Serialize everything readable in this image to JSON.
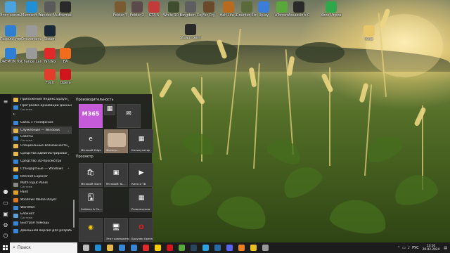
{
  "desktop": {
    "icons": [
      {
        "label": "Этот компьютер",
        "icon": "computer-icon",
        "color": "#4aa3df"
      },
      {
        "label": "Microsoft Edge",
        "icon": "edge-icon",
        "color": "#1f8fd6"
      },
      {
        "label": "Yandex Music",
        "icon": "yandex-music-icon",
        "color": "#5a5a5a"
      },
      {
        "label": "Foxmail",
        "icon": "foxmail-icon",
        "color": "#2a2a2a"
      },
      {
        "label": "Панель управления",
        "icon": "control-panel-icon",
        "color": "#2d7fd1"
      },
      {
        "label": "Отключить телеметрию",
        "icon": "privacy-icon",
        "color": "#9a9a9a"
      },
      {
        "label": "Steam",
        "icon": "steam-icon",
        "color": "#1b2838"
      },
      {
        "label": "DAEMON Tools Lite",
        "icon": "daemon-tools-icon",
        "color": "#2f7fd6"
      },
      {
        "label": "Change Language",
        "icon": "language-icon",
        "color": "#9a9a9a"
      },
      {
        "label": "Yandex",
        "icon": "yandex-browser-icon",
        "color": "#e02a2a"
      },
      {
        "label": "EA",
        "icon": "ea-icon",
        "color": "#f26c1e"
      },
      {
        "label": "Foxit",
        "icon": "foxit-icon",
        "color": "#e23c2c"
      },
      {
        "label": "Opera",
        "icon": "opera-icon",
        "color": "#d0161c"
      },
      {
        "label": "Folder 7",
        "icon": "game-folder-icon",
        "color": "#7a5a30"
      },
      {
        "label": "Folder 2",
        "icon": "game-folder-icon",
        "color": "#5a4a4a"
      },
      {
        "label": "GTA 5",
        "icon": "gta-icon",
        "color": "#c23a3a"
      },
      {
        "label": "While 10 Nature",
        "icon": "game-icon",
        "color": "#3e4e2e"
      },
      {
        "label": "Kingdom Come",
        "icon": "game-icon",
        "color": "#5e5e5e"
      },
      {
        "label": "Far Cry",
        "icon": "farcry-icon",
        "color": "#6a4a2a"
      },
      {
        "label": "Half-Life 2",
        "icon": "half-life-icon",
        "color": "#b86a1e"
      },
      {
        "label": "Counter-Strike",
        "icon": "counter-strike-icon",
        "color": "#5a6a3a"
      },
      {
        "label": "Uplay",
        "icon": "uplay-icon",
        "color": "#3b7dd8"
      },
      {
        "label": "uTorrent",
        "icon": "utorrent-icon",
        "color": "#5aa83c"
      },
      {
        "label": "Assassin's Creed",
        "icon": "assassins-creed-icon",
        "color": "#2a2a2a"
      },
      {
        "label": "Xbox Игровая",
        "icon": "xbox-icon",
        "color": "#2ea84a"
      },
      {
        "label": "Steam Game",
        "icon": "game-icon",
        "color": "#2a2a2a"
      },
      {
        "label": "Klob",
        "icon": "folder-icon",
        "color": "#e8c66a"
      }
    ]
  },
  "start_menu": {
    "rail": [
      "hamburger-icon",
      "user-icon",
      "document-icon",
      "pictures-icon",
      "settings-icon",
      "power-icon"
    ],
    "apps": [
      {
        "label": "Приложения Яндекс.Браузер",
        "sub": "",
        "icon": "folder-icon",
        "color": "#e8b84a",
        "chevron": "⌄",
        "selected": false
      },
      {
        "label": "Программа архивации данных",
        "sub": "Система",
        "icon": "backup-icon",
        "color": "#3a86d6",
        "chevron": "",
        "selected": false
      },
      {
        "label": "С",
        "sub": "",
        "icon": "",
        "color": "",
        "chevron": "",
        "selected": false
      },
      {
        "label": "Связь с телефоном",
        "sub": "",
        "icon": "phone-link-icon",
        "color": "#3a86d6",
        "chevron": "",
        "selected": false
      },
      {
        "label": "Служебные — Windows",
        "sub": "",
        "icon": "folder-icon",
        "color": "#e8b84a",
        "chevron": "⌄",
        "selected": true
      },
      {
        "label": "Советы",
        "sub": "Система",
        "icon": "tips-icon",
        "color": "#3a86d6",
        "chevron": "",
        "selected": false
      },
      {
        "label": "Специальные возможности Wi…",
        "sub": "",
        "icon": "folder-icon",
        "color": "#e8b84a",
        "chevron": "⌄",
        "selected": false
      },
      {
        "label": "Средства администрирования…",
        "sub": "",
        "icon": "folder-icon",
        "color": "#e8b84a",
        "chevron": "⌄",
        "selected": false
      },
      {
        "label": "Средство 3D-просмотра",
        "sub": "",
        "icon": "3d-viewer-icon",
        "color": "#3a86d6",
        "chevron": "",
        "selected": false
      },
      {
        "label": "Стандартные — Windows",
        "sub": "",
        "icon": "folder-icon",
        "color": "#e8b84a",
        "chevron": "⌃",
        "selected": false
      },
      {
        "label": "Internet Explorer",
        "sub": "",
        "icon": "ie-icon",
        "color": "#2d8fd9",
        "chevron": "",
        "selected": false
      },
      {
        "label": "Math Input Panel",
        "sub": "Система",
        "icon": "math-icon",
        "color": "#888888",
        "chevron": "",
        "selected": false
      },
      {
        "label": "Paint",
        "sub": "",
        "icon": "paint-icon",
        "color": "#e0a030",
        "chevron": "",
        "selected": false
      },
      {
        "label": "Windows Media Player",
        "sub": "",
        "icon": "media-player-icon",
        "color": "#e07a20",
        "chevron": "",
        "selected": false
      },
      {
        "label": "WordPad",
        "sub": "",
        "icon": "wordpad-icon",
        "color": "#3a86d6",
        "chevron": "",
        "selected": false
      },
      {
        "label": "Блокнот",
        "sub": "Система",
        "icon": "notepad-icon",
        "color": "#5aa0d8",
        "chevron": "",
        "selected": false
      },
      {
        "label": "Быстрая помощь",
        "sub": "",
        "icon": "quick-assist-icon",
        "color": "#3a86d6",
        "chevron": "",
        "selected": false
      },
      {
        "label": "Домашняя версия для разработч…",
        "sub": "",
        "icon": "dev-icon",
        "color": "#3a86d6",
        "chevron": "",
        "selected": false
      }
    ],
    "groups": {
      "productivity": "Производительность",
      "explore": "Просмотр"
    },
    "tiles": [
      {
        "label": "",
        "icon": "office-365-icon",
        "glyph": "M365",
        "color": "#c55bd8"
      },
      {
        "label": "",
        "icon": "office-apps-icon",
        "glyph": "▦",
        "color": "#3a3a3a"
      },
      {
        "label": "",
        "icon": "mail-icon",
        "glyph": "✉",
        "color": "#3a3a3a"
      },
      {
        "label": "Microsoft Edge",
        "icon": "edge-icon",
        "glyph": "e",
        "color": "#3a3a3a"
      },
      {
        "label": "Фотогр…",
        "icon": "photos-icon",
        "glyph": "",
        "color": "#8a7560"
      },
      {
        "label": "Калькулятор",
        "icon": "calculator-icon",
        "glyph": "▦",
        "color": "#3a3a3a"
      },
      {
        "label": "Microsoft Store",
        "icon": "store-icon",
        "glyph": "🛍",
        "color": "#3a3a3a"
      },
      {
        "label": "Microsoft To…",
        "icon": "todo-icon",
        "glyph": "▣",
        "color": "#3a3a3a"
      },
      {
        "label": "Кино и ТВ",
        "icon": "movies-icon",
        "glyph": "▶",
        "color": "#3a3a3a"
      },
      {
        "label": "Solitaire & Ca…",
        "icon": "solitaire-icon",
        "glyph": "🂡",
        "color": "#3a3a3a"
      },
      {
        "label": "Развлечения",
        "icon": "entertainment-icon",
        "glyph": "▦",
        "color": "#3a3a3a"
      },
      {
        "label": "Этот компьютер",
        "icon": "this-pc-icon",
        "glyph": "🖥",
        "color": "#3a3a3a"
      },
      {
        "label": "Браузер Opera",
        "icon": "opera-icon",
        "glyph": "O",
        "color": "#3a3a3a"
      },
      {
        "label": "",
        "icon": "yandex-music-icon",
        "glyph": "◉",
        "color": "#3a3a3a"
      }
    ]
  },
  "taskbar": {
    "search_placeholder": "Поиск",
    "pinned": [
      {
        "icon": "task-view-icon",
        "color": "#bbbbbb"
      },
      {
        "icon": "edge-icon",
        "color": "#1f8fd6"
      },
      {
        "icon": "explorer-icon",
        "color": "#e8b84a"
      },
      {
        "icon": "store-icon",
        "color": "#3a86d6"
      },
      {
        "icon": "mail-icon",
        "color": "#3a86d6"
      },
      {
        "icon": "yandex-browser-icon",
        "color": "#e02a2a"
      },
      {
        "icon": "yandex-icon",
        "color": "#ffcc00"
      },
      {
        "icon": "opera-icon",
        "color": "#d0161c"
      },
      {
        "icon": "utorrent-icon",
        "color": "#5aa83c"
      },
      {
        "icon": "steam-icon",
        "color": "#2a475e"
      },
      {
        "icon": "telegram-icon",
        "color": "#2aa3df"
      },
      {
        "icon": "photoshop-icon",
        "color": "#2a6aa8"
      },
      {
        "icon": "discord-icon",
        "color": "#5865f2"
      },
      {
        "icon": "vlc-icon",
        "color": "#f08020"
      },
      {
        "icon": "chrome-icon",
        "color": "#e8c020"
      },
      {
        "icon": "settings-icon",
        "color": "#999999"
      }
    ],
    "language": "РУС",
    "time": "13:10",
    "date": "20.02.2024"
  }
}
